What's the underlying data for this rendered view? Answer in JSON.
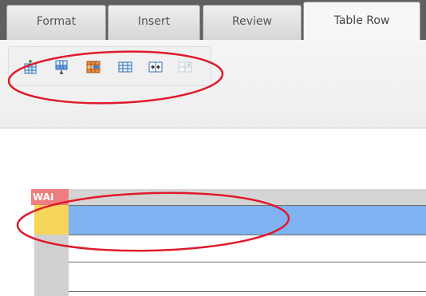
{
  "tabs": [
    {
      "label": "Format",
      "active": false
    },
    {
      "label": "Insert",
      "active": false
    },
    {
      "label": "Review",
      "active": false
    },
    {
      "label": "Table Row",
      "active": true
    }
  ],
  "toolbar": {
    "buttons": [
      {
        "icon": "insert-row-above-icon",
        "enabled": true
      },
      {
        "icon": "insert-row-below-icon",
        "enabled": true
      },
      {
        "icon": "delete-row-icon",
        "enabled": true
      },
      {
        "icon": "table-properties-icon",
        "enabled": true
      },
      {
        "icon": "merge-cells-icon",
        "enabled": true
      },
      {
        "icon": "split-cells-icon",
        "enabled": false
      }
    ]
  },
  "table": {
    "badge": "WAI",
    "rows": 3,
    "selected_row": 1
  },
  "colors": {
    "tab_strip": "#5f5f5f",
    "selected_row": "#7fb2f0",
    "row_handle": "#f7d45a",
    "badge": "#ef7d7d",
    "annotation": "#e0192b"
  }
}
